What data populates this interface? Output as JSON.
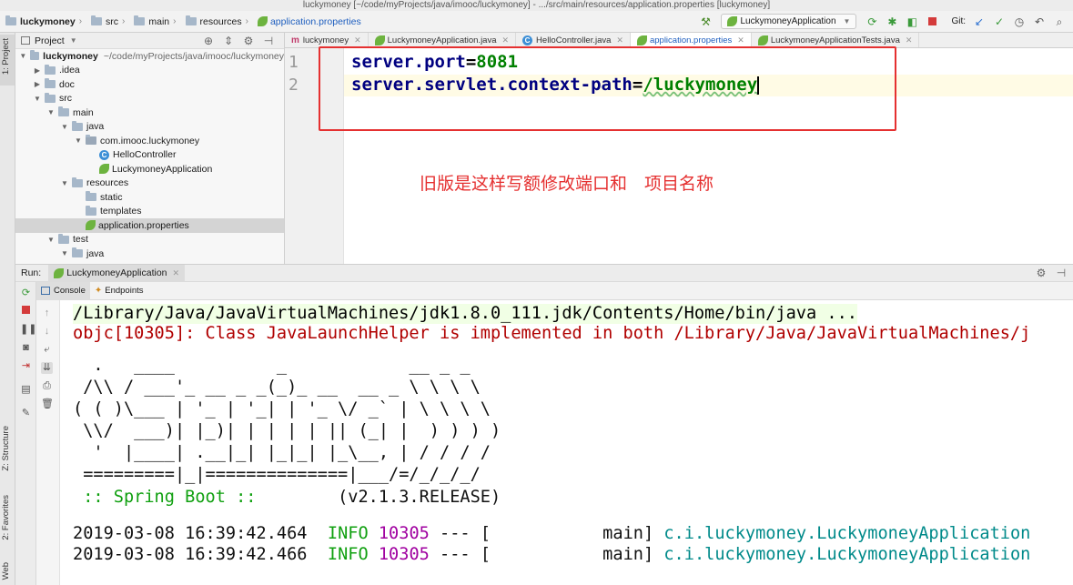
{
  "window": {
    "title": "luckymoney [~/code/myProjects/java/imooc/luckymoney] - .../src/main/resources/application.properties [luckymoney]"
  },
  "breadcrumbs": [
    "luckymoney",
    "src",
    "main",
    "resources",
    "application.properties"
  ],
  "toolbar": {
    "run_config": "LuckymoneyApplication",
    "git_label": "Git:"
  },
  "sidebar_left": {
    "project_label": "1: Project",
    "structure_label": "Z: Structure",
    "favorites_label": "2: Favorites",
    "web_label": "Web"
  },
  "project_panel": {
    "header": "Project",
    "tree": [
      {
        "label": "luckymoney",
        "extra": "~/code/myProjects/java/imooc/luckymoney",
        "depth": 0,
        "expanded": true,
        "icon": "folder-icon",
        "bold": true
      },
      {
        "label": ".idea",
        "depth": 1,
        "expanded": false,
        "icon": "folder-icon"
      },
      {
        "label": "doc",
        "depth": 1,
        "expanded": false,
        "icon": "folder-icon"
      },
      {
        "label": "src",
        "depth": 1,
        "expanded": true,
        "icon": "folder-icon"
      },
      {
        "label": "main",
        "depth": 2,
        "expanded": true,
        "icon": "folder-icon"
      },
      {
        "label": "java",
        "depth": 3,
        "expanded": true,
        "icon": "folder-icon"
      },
      {
        "label": "com.imooc.luckymoney",
        "depth": 4,
        "expanded": true,
        "icon": "package-icon"
      },
      {
        "label": "HelloController",
        "depth": 5,
        "icon": "class-icon"
      },
      {
        "label": "LuckymoneyApplication",
        "depth": 5,
        "icon": "spring-class-icon"
      },
      {
        "label": "resources",
        "depth": 3,
        "expanded": true,
        "icon": "folder-icon"
      },
      {
        "label": "static",
        "depth": 4,
        "icon": "folder-icon"
      },
      {
        "label": "templates",
        "depth": 4,
        "icon": "folder-icon"
      },
      {
        "label": "application.properties",
        "depth": 4,
        "icon": "spring-leaf-icon",
        "selected": true
      },
      {
        "label": "test",
        "depth": 2,
        "expanded": true,
        "icon": "folder-icon"
      },
      {
        "label": "java",
        "depth": 3,
        "expanded": true,
        "icon": "folder-icon"
      }
    ]
  },
  "editor_tabs": [
    {
      "label": "luckymoney",
      "icon": "maven-icon",
      "active": false
    },
    {
      "label": "LuckymoneyApplication.java",
      "icon": "spring-class-icon",
      "active": false
    },
    {
      "label": "HelloController.java",
      "icon": "class-icon",
      "active": false
    },
    {
      "label": "application.properties",
      "icon": "spring-leaf-icon",
      "active": true
    },
    {
      "label": "LuckymoneyApplicationTests.java",
      "icon": "spring-class-icon",
      "active": false
    }
  ],
  "editor": {
    "line_numbers": [
      "1",
      "2"
    ],
    "line1": {
      "key": "server.port",
      "eq": "=",
      "value": "8081"
    },
    "line2": {
      "key": "server.servlet.context-path",
      "eq": "=",
      "value": "/luckymoney"
    }
  },
  "annotation": {
    "text": "旧版是这样写额修改端口和　项目名称",
    "color": "#e53030"
  },
  "run_panel": {
    "run_label": "Run:",
    "run_tab": "LuckymoneyApplication",
    "subtabs": [
      "Console",
      "Endpoints"
    ]
  },
  "console": {
    "java_cmd": "/Library/Java/JavaVirtualMachines/jdk1.8.0_111.jdk/Contents/Home/bin/java ...",
    "objc_warning": "objc[10305]: Class JavaLaunchHelper is implemented in both /Library/Java/JavaVirtualMachines/j",
    "banner": [
      "  .   ____          _            __ _ _",
      " /\\\\ / ___'_ __ _ _(_)_ __  __ _ \\ \\ \\ \\",
      "( ( )\\___ | '_ | '_| | '_ \\/ _` | \\ \\ \\ \\",
      " \\\\/  ___)| |_)| | | | | || (_| |  ) ) ) )",
      "  '  |____| .__|_| |_|_| |_\\__, | / / / /",
      " =========|_|==============|___/=/_/_/_/"
    ],
    "spring_boot_label": " :: Spring Boot :: ",
    "spring_boot_version": "       (v2.1.3.RELEASE)",
    "logs": [
      {
        "timestamp": "2019-03-08 16:39:42.464",
        "level": "INFO",
        "pid": "10305",
        "sep": "---",
        "thread": "[           main]",
        "logger": "c.i.luckymoney.LuckymoneyApplication"
      },
      {
        "timestamp": "2019-03-08 16:39:42.466",
        "level": "INFO",
        "pid": "10305",
        "sep": "---",
        "thread": "[           main]",
        "logger": "c.i.luckymoney.LuckymoneyApplication"
      }
    ]
  },
  "colors": {
    "accent_red": "#e53030",
    "spring_green": "#6db33f",
    "info_green": "#10a010",
    "pid_magenta": "#a000a0",
    "logger_cyan": "#008a8a"
  }
}
